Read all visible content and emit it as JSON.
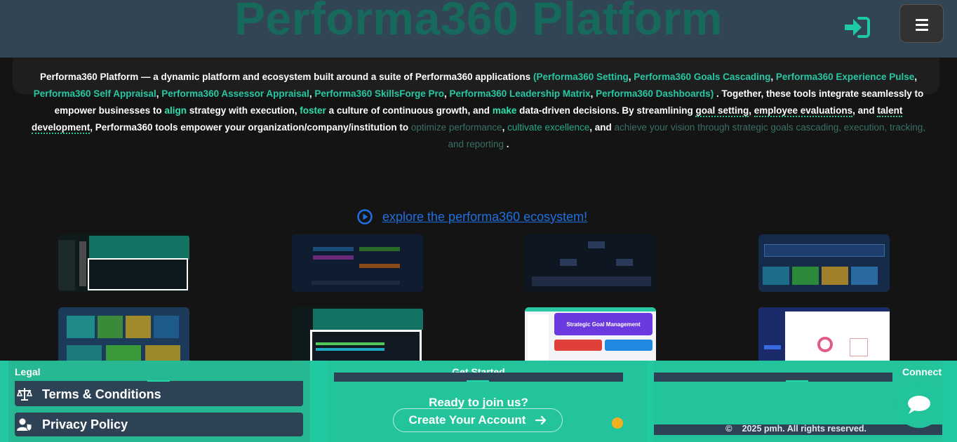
{
  "header": {
    "brand": "Performa360 Platform",
    "login_icon": "login-icon",
    "menu_icon": "hamburger-menu-icon"
  },
  "intro": {
    "p1": "Performa360 Platform — a dynamic platform and ecosystem built around a suite of Performa360 applications",
    "open": "(",
    "apps": [
      "Performa360 Setting",
      "Performa360 Goals Cascading",
      "Performa360 Experience Pulse",
      "Performa360 Self Appraisal",
      "Performa360 Assessor Appraisal",
      "Performa360 SkillsForge Pro",
      "Performa360 Leadership Matrix",
      "Performa360 Dashboards"
    ],
    "close": ")",
    "p2": ". Together, these tools integrate seamlessly to empower businesses to",
    "kw1": "align",
    "p3": "strategy with execution,",
    "kw2": "foster",
    "p4": "a culture of continuous growth, and",
    "kw3": "make",
    "p5": "data-driven decisions. By streamlining",
    "u1": "goal setting",
    "sep1": ",",
    "u2": "employee evaluations",
    "sep2": ", and",
    "u3": "talent development",
    "p6": ", Performa360 tools empower your organization/company/institution to",
    "g1": "optimize performance",
    "sep3": ",",
    "g2": "cultivate excellence",
    "sep4": ", and",
    "g3": "achieve your vision through strategic goals cascading, execution, tracking, and reporting",
    "end": "."
  },
  "explore": {
    "label": "explore the performa360 ecosystem!",
    "icon": "play-circle-icon"
  },
  "thumbnails": {
    "card1": "Strategic Goal Management"
  },
  "footer": {
    "legal_heading": "Legal",
    "terms": "Terms & Conditions",
    "privacy": "Privacy Policy",
    "start_heading": "Get Started",
    "ready": "Ready to join us?",
    "cta": "Create Your Account",
    "connect_heading": "Connect",
    "copyright": "2025 pmh. All rights reserved."
  },
  "colors": {
    "accent": "#22c9a0",
    "header": "#324555",
    "link": "#1f6fe0"
  }
}
